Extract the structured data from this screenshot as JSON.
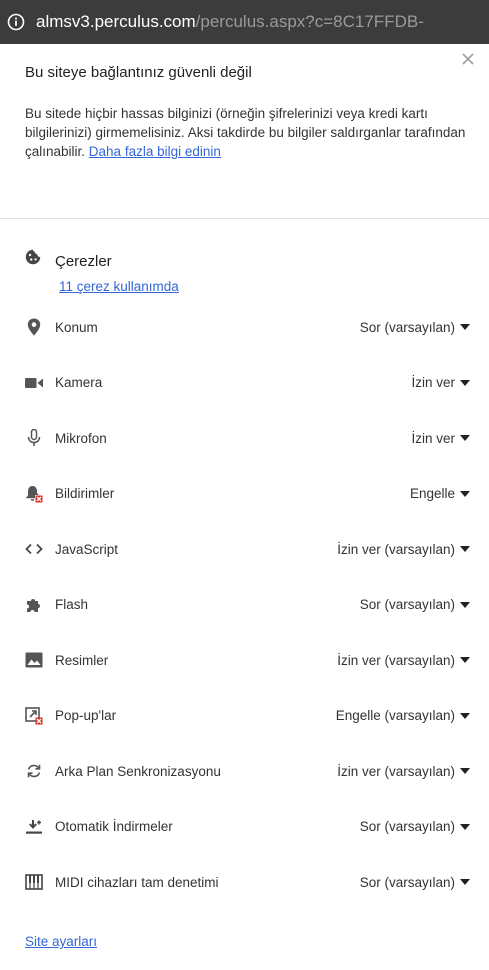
{
  "urlbar": {
    "host": "almsv3.perculus.com",
    "path": "/perculus.aspx?c=8C17FFDB-"
  },
  "warning": {
    "title": "Bu siteye bağlantınız güvenli değil",
    "body": "Bu sitede hiçbir hassas bilginizi (örneğin şifrelerinizi veya kredi kartı bilgilerinizi) girmemelisiniz. Aksi takdirde bu bilgiler saldırganlar tarafından çalınabilir. ",
    "more_link": "Daha fazla bilgi edinin"
  },
  "cookies": {
    "label": "Çerezler",
    "link": "11 çerez kullanımda"
  },
  "permissions": [
    {
      "label": "Konum",
      "value": "Sor (varsayılan)",
      "icon": "location-pin-icon"
    },
    {
      "label": "Kamera",
      "value": "İzin ver",
      "icon": "camera-icon"
    },
    {
      "label": "Mikrofon",
      "value": "İzin ver",
      "icon": "microphone-icon"
    },
    {
      "label": "Bildirimler",
      "value": "Engelle",
      "icon": "notifications-blocked-icon"
    },
    {
      "label": "JavaScript",
      "value": "İzin ver (varsayılan)",
      "icon": "code-icon"
    },
    {
      "label": "Flash",
      "value": "Sor (varsayılan)",
      "icon": "puzzle-icon"
    },
    {
      "label": "Resimler",
      "value": "İzin ver (varsayılan)",
      "icon": "image-icon"
    },
    {
      "label": "Pop-up'lar",
      "value": "Engelle (varsayılan)",
      "icon": "popup-blocked-icon"
    },
    {
      "label": "Arka Plan Senkronizasyonu",
      "value": "İzin ver (varsayılan)",
      "icon": "sync-icon"
    },
    {
      "label": "Otomatik İndirmeler",
      "value": "Sor (varsayılan)",
      "icon": "download-icon"
    },
    {
      "label": "MIDI cihazları tam denetimi",
      "value": "Sor (varsayılan)",
      "icon": "piano-icon"
    }
  ],
  "footer": {
    "site_settings": "Site ayarları"
  },
  "colors": {
    "link": "#3367d6",
    "urlbar_bg": "#3c3c3c",
    "blocked_badge": "#d93025"
  }
}
